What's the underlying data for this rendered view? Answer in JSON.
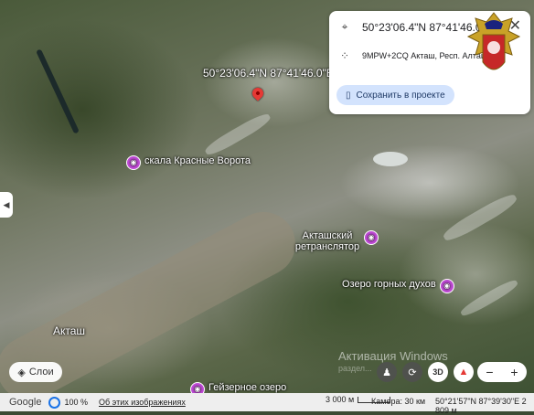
{
  "map": {
    "selected_coordinates": "50°23'06.4\"N 87°41'46.0\"E",
    "places": [
      {
        "name": "скала Красные Ворота",
        "icon": "camera-icon"
      },
      {
        "name": "Акташский ретранслятор",
        "icon": "camera-icon"
      },
      {
        "name": "Озеро горных духов",
        "icon": "camera-icon"
      },
      {
        "name": "Акташ",
        "icon": ""
      },
      {
        "name": "Гейзерное озеро",
        "icon": "camera-icon"
      }
    ]
  },
  "info_card": {
    "coordinates": "50°23'06.4\"N 87°41'46.0\"E",
    "plus_code": "9MPW+2CQ Акташ, Респ. Алтай",
    "save_label": "Сохранить в проекте"
  },
  "controls": {
    "layers_label": "Слои",
    "zoom_in": "+",
    "zoom_out": "−",
    "view_3d": "3D"
  },
  "watermark": {
    "line1": "Активация Windows",
    "line2": "раздел..."
  },
  "status_bar": {
    "logo": "Google",
    "zoom_percent": "100 %",
    "about_link": "Об этих изображениях",
    "scale": "3 000 м",
    "camera": "Камера: 30 км",
    "cursor_coords": "50°21'57\"N 87°39'30\"E 2 809 м"
  }
}
